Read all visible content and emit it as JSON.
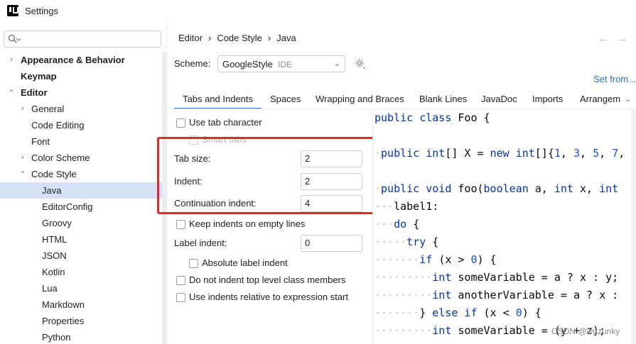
{
  "window": {
    "title": "Settings"
  },
  "search": {
    "placeholder": ""
  },
  "tree": [
    {
      "label": "Appearance & Behavior",
      "bold": true,
      "chevron": "right",
      "level": 0
    },
    {
      "label": "Keymap",
      "bold": true,
      "chevron": "",
      "level": 0
    },
    {
      "label": "Editor",
      "bold": true,
      "chevron": "down",
      "level": 0
    },
    {
      "label": "General",
      "chevron": "right",
      "level": 1
    },
    {
      "label": "Code Editing",
      "chevron": "",
      "level": 1
    },
    {
      "label": "Font",
      "chevron": "",
      "level": 1
    },
    {
      "label": "Color Scheme",
      "chevron": "right",
      "level": 1
    },
    {
      "label": "Code Style",
      "chevron": "down",
      "level": 1
    },
    {
      "label": "Java",
      "chevron": "",
      "level": 2,
      "selected": true
    },
    {
      "label": "EditorConfig",
      "chevron": "",
      "level": 2
    },
    {
      "label": "Groovy",
      "chevron": "",
      "level": 2
    },
    {
      "label": "HTML",
      "chevron": "",
      "level": 2
    },
    {
      "label": "JSON",
      "chevron": "",
      "level": 2
    },
    {
      "label": "Kotlin",
      "chevron": "",
      "level": 2
    },
    {
      "label": "Lua",
      "chevron": "",
      "level": 2
    },
    {
      "label": "Markdown",
      "chevron": "",
      "level": 2
    },
    {
      "label": "Properties",
      "chevron": "",
      "level": 2
    },
    {
      "label": "Python",
      "chevron": "",
      "level": 2
    }
  ],
  "breadcrumb": [
    "Editor",
    "Code Style",
    "Java"
  ],
  "breadcrumb_sep": "›",
  "nav": {
    "back": "←",
    "forward": "→"
  },
  "scheme": {
    "label": "Scheme:",
    "value": "GoogleStyle",
    "tag": "IDE"
  },
  "set_from": "Set from...",
  "tabs": [
    "Tabs and Indents",
    "Spaces",
    "Wrapping and Braces",
    "Blank Lines",
    "JavaDoc",
    "Imports",
    "Arrangem"
  ],
  "active_tab": "Tabs and Indents",
  "options": {
    "use_tab_character": {
      "label": "Use tab character",
      "checked": false
    },
    "smart_tabs": {
      "label": "Smart tabs",
      "checked": false,
      "disabled": true
    },
    "tab_size": {
      "label": "Tab size:",
      "value": "2"
    },
    "indent": {
      "label": "Indent:",
      "value": "2"
    },
    "continuation_indent": {
      "label": "Continuation indent:",
      "value": "4"
    },
    "keep_indents_empty": {
      "label": "Keep indents on empty lines",
      "checked": false
    },
    "label_indent": {
      "label": "Label indent:",
      "value": "0"
    },
    "absolute_label_indent": {
      "label": "Absolute label indent",
      "checked": false
    },
    "no_indent_top_level": {
      "label": "Do not indent top level class members",
      "checked": false
    },
    "indents_relative": {
      "label": "Use indents relative to expression start",
      "checked": false
    }
  },
  "code_lines": [
    [
      [
        "kw",
        "public class "
      ],
      [
        "",
        "Foo {"
      ]
    ],
    [],
    [
      [
        "dots",
        "·"
      ],
      [
        "kw",
        "public "
      ],
      [
        "kw",
        "int"
      ],
      [
        "",
        "[] X = "
      ],
      [
        "kw",
        "new "
      ],
      [
        "kw",
        "int"
      ],
      [
        "",
        "[]{"
      ],
      [
        "num",
        "1"
      ],
      [
        "",
        ", "
      ],
      [
        "num",
        "3"
      ],
      [
        "",
        ", "
      ],
      [
        "num",
        "5"
      ],
      [
        "",
        ", "
      ],
      [
        "num",
        "7"
      ],
      [
        "",
        ","
      ]
    ],
    [],
    [
      [
        "dots",
        "·"
      ],
      [
        "kw",
        "public void "
      ],
      [
        "",
        "foo("
      ],
      [
        "kw",
        "boolean "
      ],
      [
        "",
        "a, "
      ],
      [
        "kw",
        "int "
      ],
      [
        "",
        "x, "
      ],
      [
        "kw",
        "int"
      ]
    ],
    [
      [
        "dots",
        "···"
      ],
      [
        "",
        "label1:"
      ]
    ],
    [
      [
        "dots",
        "···"
      ],
      [
        "kw",
        "do "
      ],
      [
        "",
        "{"
      ]
    ],
    [
      [
        "dots",
        "·····"
      ],
      [
        "kw",
        "try "
      ],
      [
        "",
        "{"
      ]
    ],
    [
      [
        "dots",
        "·······"
      ],
      [
        "kw",
        "if "
      ],
      [
        "",
        "(x > "
      ],
      [
        "num",
        "0"
      ],
      [
        "",
        ") {"
      ]
    ],
    [
      [
        "dots",
        "·········"
      ],
      [
        "kw",
        "int "
      ],
      [
        "",
        "someVariable = a ? x : y;"
      ]
    ],
    [
      [
        "dots",
        "·········"
      ],
      [
        "kw",
        "int "
      ],
      [
        "",
        "anotherVariable = a ? x : "
      ]
    ],
    [
      [
        "dots",
        "·······"
      ],
      [
        "",
        "} "
      ],
      [
        "kw",
        "else if "
      ],
      [
        "",
        "(x < "
      ],
      [
        "num",
        "0"
      ],
      [
        "",
        ") {"
      ]
    ],
    [
      [
        "dots",
        "·········"
      ],
      [
        "kw",
        "int "
      ],
      [
        "",
        "someVariable = (y + z);"
      ]
    ]
  ],
  "watermark": "CSDN @wgzunky"
}
